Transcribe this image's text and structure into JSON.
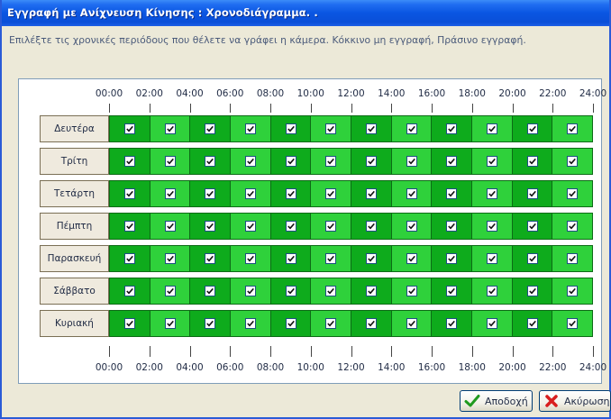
{
  "window": {
    "title": "Εγγραφή με Ανίχνευση Κίνησης : Χρονοδιάγραμμα. ."
  },
  "instruction": "Επιλέξτε τις χρονικές περιόδους που θέλετε να γράφει η κάμερα. Κόκκινο μη εγγραφή, Πράσινο εγγραφή.",
  "schedule": {
    "time_labels": [
      "00:00",
      "02:00",
      "04:00",
      "06:00",
      "08:00",
      "10:00",
      "12:00",
      "14:00",
      "16:00",
      "18:00",
      "20:00",
      "22:00",
      "24:00"
    ],
    "days": [
      "Δευτέρα",
      "Τρίτη",
      "Τετάρτη",
      "Πέμπτη",
      "Παρασκευή",
      "Σάββατο",
      "Κυριακή"
    ],
    "slots_per_day": 12,
    "all_slots_recording": true,
    "recording_color": "#0eab1c",
    "recording_color_alt": "#2fd13b",
    "no_recording_color": "#d00000"
  },
  "buttons": {
    "accept_label": "Αποδοχή",
    "cancel_label": "Ακύρωση"
  },
  "icons": {
    "accept": "checkmark-icon",
    "cancel": "red-x-icon"
  }
}
